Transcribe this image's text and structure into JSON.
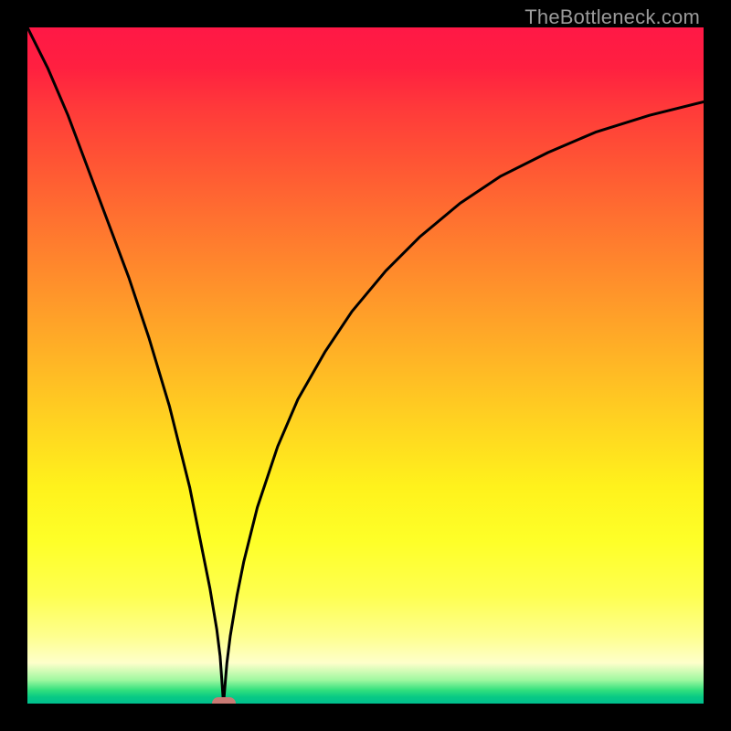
{
  "watermark": "TheBottleneck.com",
  "chart_data": {
    "type": "line",
    "title": "",
    "xlabel": "",
    "ylabel": "",
    "xlim": [
      0,
      100
    ],
    "ylim": [
      0,
      100
    ],
    "marker": {
      "x": 29,
      "y": 0
    },
    "series": [
      {
        "name": "curve",
        "x": [
          0,
          3,
          6,
          9,
          12,
          15,
          18,
          21,
          24,
          26,
          27,
          28,
          28.5,
          29,
          29.5,
          30,
          31,
          32,
          34,
          37,
          40,
          44,
          48,
          53,
          58,
          64,
          70,
          77,
          84,
          92,
          100
        ],
        "y": [
          100,
          94,
          87,
          79,
          71,
          63,
          54,
          44,
          32,
          22,
          17,
          11,
          7,
          0,
          6,
          10,
          16,
          21,
          29,
          38,
          45,
          52,
          58,
          64,
          69,
          74,
          78,
          81.5,
          84.5,
          87,
          89
        ]
      }
    ]
  }
}
